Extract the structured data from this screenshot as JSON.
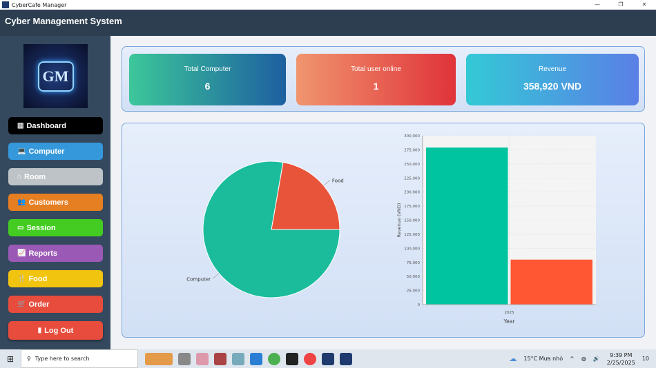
{
  "window": {
    "title": "CyberCafe Manager",
    "min": "—",
    "max": "❐",
    "close": "✕"
  },
  "header": {
    "title": "Cyber Management System"
  },
  "logo": {
    "text": "GM"
  },
  "sidebar": {
    "items": [
      {
        "label": "Dashboard",
        "icon": "chart-icon",
        "glyph": "▥",
        "color": "#000000"
      },
      {
        "label": "Computer",
        "icon": "laptop-icon",
        "glyph": "💻",
        "color": "#3498db"
      },
      {
        "label": "Room",
        "icon": "home-icon",
        "glyph": "⌂",
        "color": "#bdc3c7"
      },
      {
        "label": "Customers",
        "icon": "users-icon",
        "glyph": "👥",
        "color": "#e67e22"
      },
      {
        "label": "Session",
        "icon": "monitor-icon",
        "glyph": "▭",
        "color": "#44cc22"
      },
      {
        "label": "Reports",
        "icon": "line-chart-icon",
        "glyph": "📈",
        "color": "#9b59b6"
      },
      {
        "label": "Food",
        "icon": "food-icon",
        "glyph": "🍴",
        "color": "#f1c40f"
      },
      {
        "label": "Order",
        "icon": "cart-icon",
        "glyph": "🛒",
        "color": "#e74c3c"
      },
      {
        "label": "Log Out",
        "icon": "door-icon",
        "glyph": "▮",
        "color": "#e74c3c"
      }
    ]
  },
  "cards": [
    {
      "label": "Total Computer",
      "value": "6"
    },
    {
      "label": "Total user online",
      "value": "1"
    },
    {
      "label": "Revenue",
      "value": "358,920 VND"
    }
  ],
  "chart_data": [
    {
      "type": "pie",
      "slices": [
        {
          "label": "Computer",
          "value": 279000,
          "color": "#1abc9c"
        },
        {
          "label": "Food",
          "value": 79920,
          "color": "#e8543a"
        }
      ]
    },
    {
      "type": "bar",
      "categories": [
        "2025"
      ],
      "series": [
        {
          "values": [
            279000
          ],
          "color": "#00c49f"
        },
        {
          "values": [
            79920
          ],
          "color": "#ff5733"
        }
      ],
      "xlabel": "Year",
      "ylabel": "Revenue (VND)",
      "ylim": [
        0,
        300000
      ],
      "yticks": [
        0,
        25000,
        50000,
        75000,
        100000,
        125000,
        150000,
        175000,
        200000,
        225000,
        250000,
        275000,
        300000
      ],
      "grid": true
    }
  ],
  "taskbar": {
    "search": "Type here to search",
    "weather": "15°C  Mưa nhỏ",
    "time": "9:39 PM",
    "date": "2/25/2025",
    "notifications": "10"
  }
}
